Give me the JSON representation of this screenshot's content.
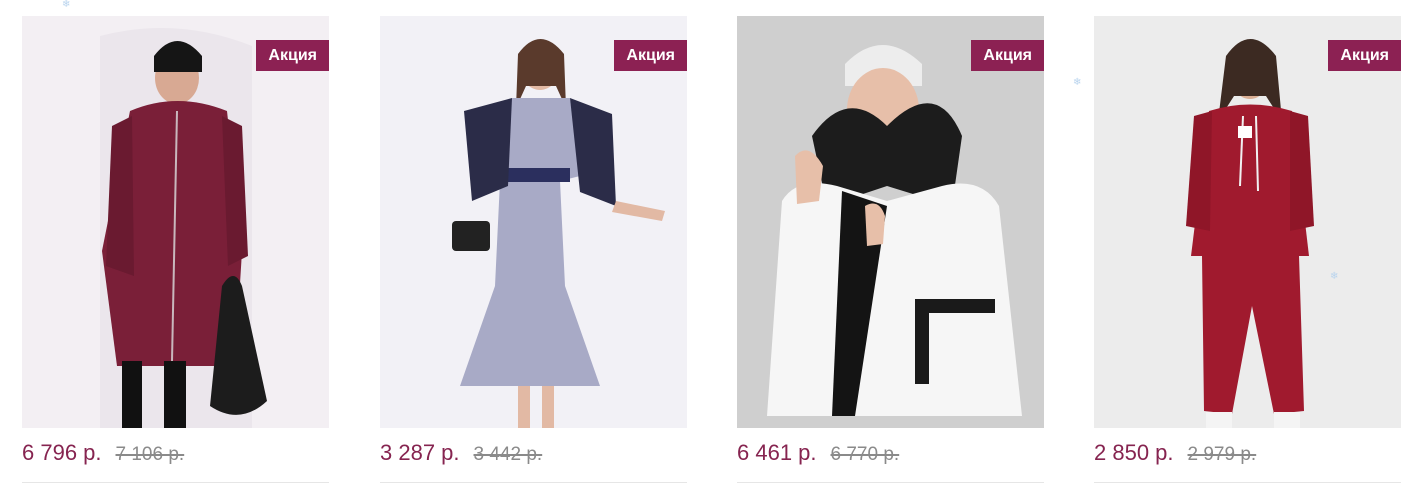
{
  "colors": {
    "badge_bg": "#8c2153",
    "badge_text": "#ffffff",
    "price_current": "#862450",
    "price_old": "#8a8a8a",
    "divider": "#e6e6e6"
  },
  "products": [
    {
      "badge": "Акция",
      "price": "6 796 р.",
      "old_price": "7 106 р.",
      "image": "burgundy-quilted-long-coat-photo"
    },
    {
      "badge": "Акция",
      "price": "3 287 р.",
      "old_price": "3 442 р.",
      "image": "lavender-double-breasted-dress-photo"
    },
    {
      "badge": "Акция",
      "price": "6 461 р.",
      "old_price": "6 770 р.",
      "image": "white-puffer-jacket-photo"
    },
    {
      "badge": "Акция",
      "price": "2 850 р.",
      "old_price": "2 979 р.",
      "image": "red-hoodie-tracksuit-photo"
    }
  ]
}
